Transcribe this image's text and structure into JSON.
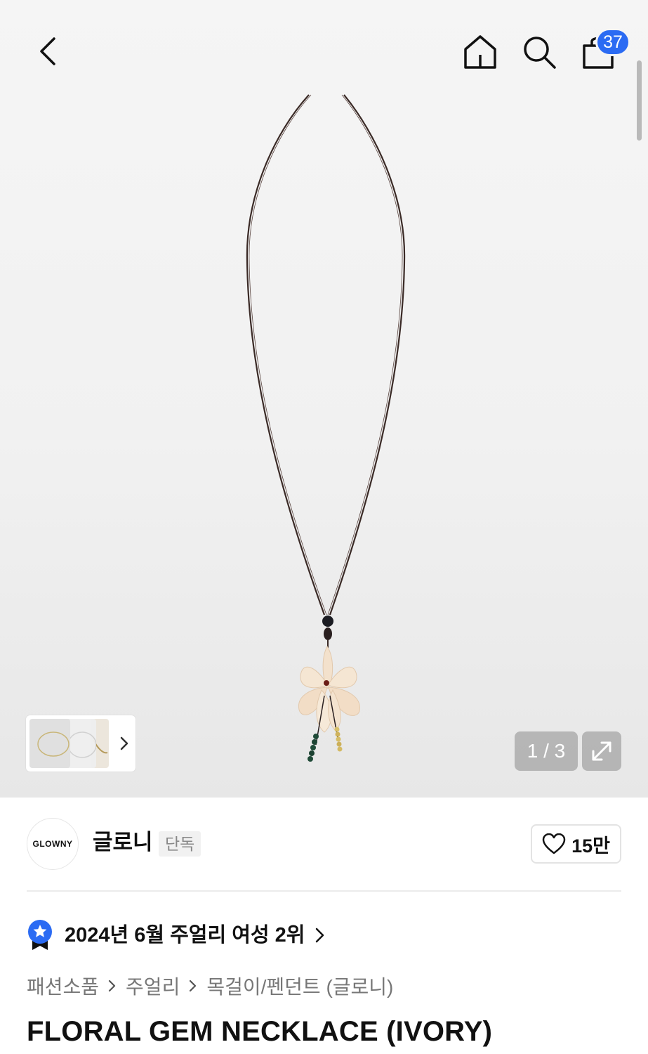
{
  "header": {
    "cart_count": "37",
    "icons": [
      "chevron-left-icon",
      "home-icon",
      "search-icon",
      "shopping-bag-icon"
    ]
  },
  "gallery": {
    "page_indicator": "1 / 3",
    "current_page": 1,
    "total_pages": 3
  },
  "brand": {
    "logo_text": "GLOWNY",
    "name": "글로니",
    "tag": "단독",
    "likes": "15만"
  },
  "ranking": {
    "text": "2024년 6월 주얼리 여성 2위",
    "badge_color": "#2b6bf3"
  },
  "breadcrumb": [
    "패션소품",
    "주얼리",
    "목걸이/펜던트 (글로니)"
  ],
  "product": {
    "title": "FLORAL GEM NECKLACE (IVORY)"
  },
  "colors": {
    "accent": "#2b6bf3",
    "cord": "#3a2a26",
    "flower": "#f3e1cc"
  }
}
